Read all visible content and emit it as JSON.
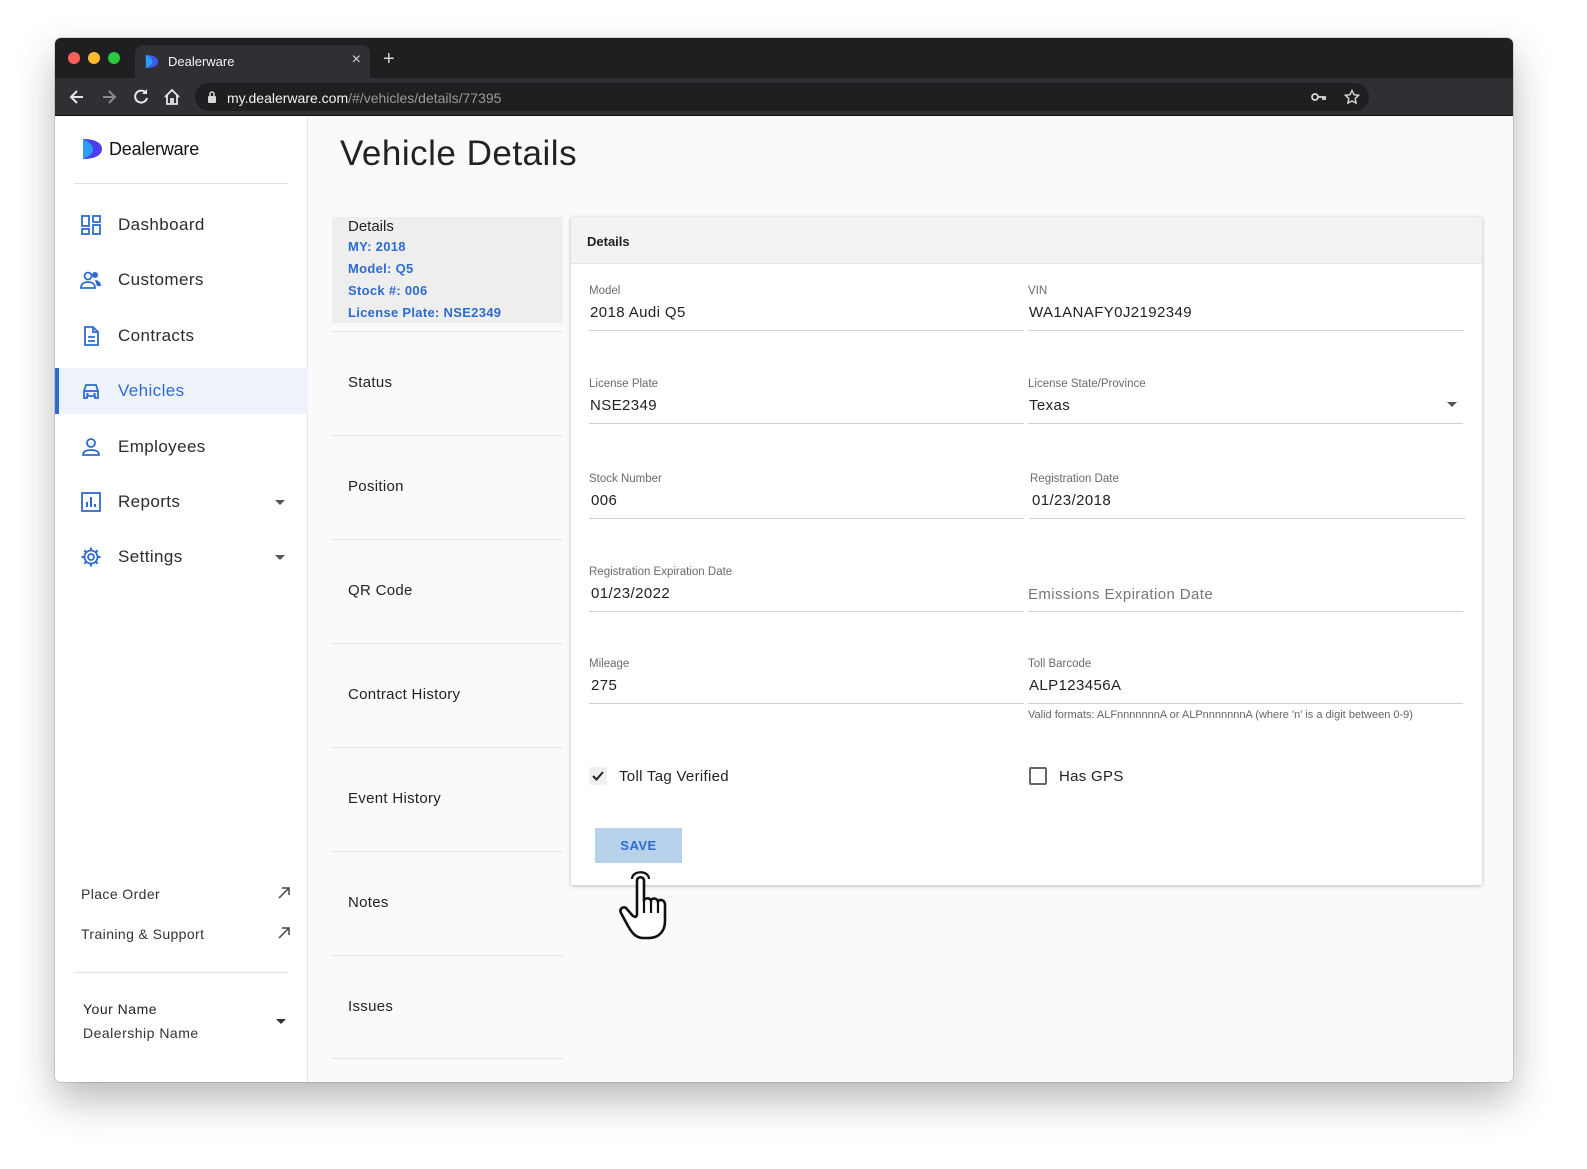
{
  "browser": {
    "tab_title": "Dealerware",
    "tab_close": "×",
    "new_tab": "+",
    "url_host": "my.dealerware.com",
    "url_path": "/#/vehicles/details/77395"
  },
  "sidebar": {
    "logo_text": "Dealerware",
    "items": [
      {
        "label": "Dashboard",
        "icon": "dashboard-icon"
      },
      {
        "label": "Customers",
        "icon": "people-icon"
      },
      {
        "label": "Contracts",
        "icon": "document-icon"
      },
      {
        "label": "Vehicles",
        "icon": "car-icon",
        "active": true
      },
      {
        "label": "Employees",
        "icon": "person-icon"
      },
      {
        "label": "Reports",
        "icon": "bar-chart-icon",
        "has_dropdown": true
      },
      {
        "label": "Settings",
        "icon": "gear-icon",
        "has_dropdown": true
      }
    ],
    "external_links": [
      {
        "label": "Place Order",
        "icon": "external-arrow-icon"
      },
      {
        "label": "Training & Support",
        "icon": "external-arrow-icon"
      }
    ],
    "user": {
      "name": "Your Name",
      "dealership": "Dealership Name"
    }
  },
  "main": {
    "title": "Vehicle Details",
    "subnav": {
      "details": {
        "heading": "Details",
        "lines": [
          "MY: 2018",
          "Model: Q5",
          "Stock #: 006",
          "License Plate: NSE2349"
        ]
      },
      "items": [
        "Status",
        "Position",
        "QR Code",
        "Contract History",
        "Event History",
        "Notes",
        "Issues"
      ]
    },
    "card": {
      "heading": "Details",
      "fields": {
        "model": {
          "label": "Model",
          "value": "2018 Audi Q5"
        },
        "vin": {
          "label": "VIN",
          "value": "WA1ANAFY0J2192349"
        },
        "license_plate": {
          "label": "License Plate",
          "value": "NSE2349"
        },
        "license_state": {
          "label": "License State/Province",
          "value": "Texas"
        },
        "stock_number": {
          "label": "Stock Number",
          "value": "006"
        },
        "registration_date": {
          "label": "Registration Date",
          "value": "01/23/2018"
        },
        "registration_expiration": {
          "label": "Registration Expiration Date",
          "value": "01/23/2022"
        },
        "emissions_expiration": {
          "placeholder": "Emissions Expiration Date"
        },
        "mileage": {
          "label": "Mileage",
          "value": "275"
        },
        "toll_barcode": {
          "label": "Toll Barcode",
          "value": "ALP123456A",
          "helper": "Valid formats: ALFnnnnnnnA or ALPnnnnnnnA (where 'n' is a digit between 0-9)"
        }
      },
      "checkboxes": {
        "toll_tag_verified": {
          "label": "Toll Tag Verified",
          "checked": true
        },
        "has_gps": {
          "label": "Has GPS",
          "checked": false
        }
      },
      "save_label": "SAVE"
    }
  },
  "colors": {
    "accent": "#2d6bd1",
    "save_bg": "#b8d1ea",
    "active_bg": "#eef3fb"
  }
}
